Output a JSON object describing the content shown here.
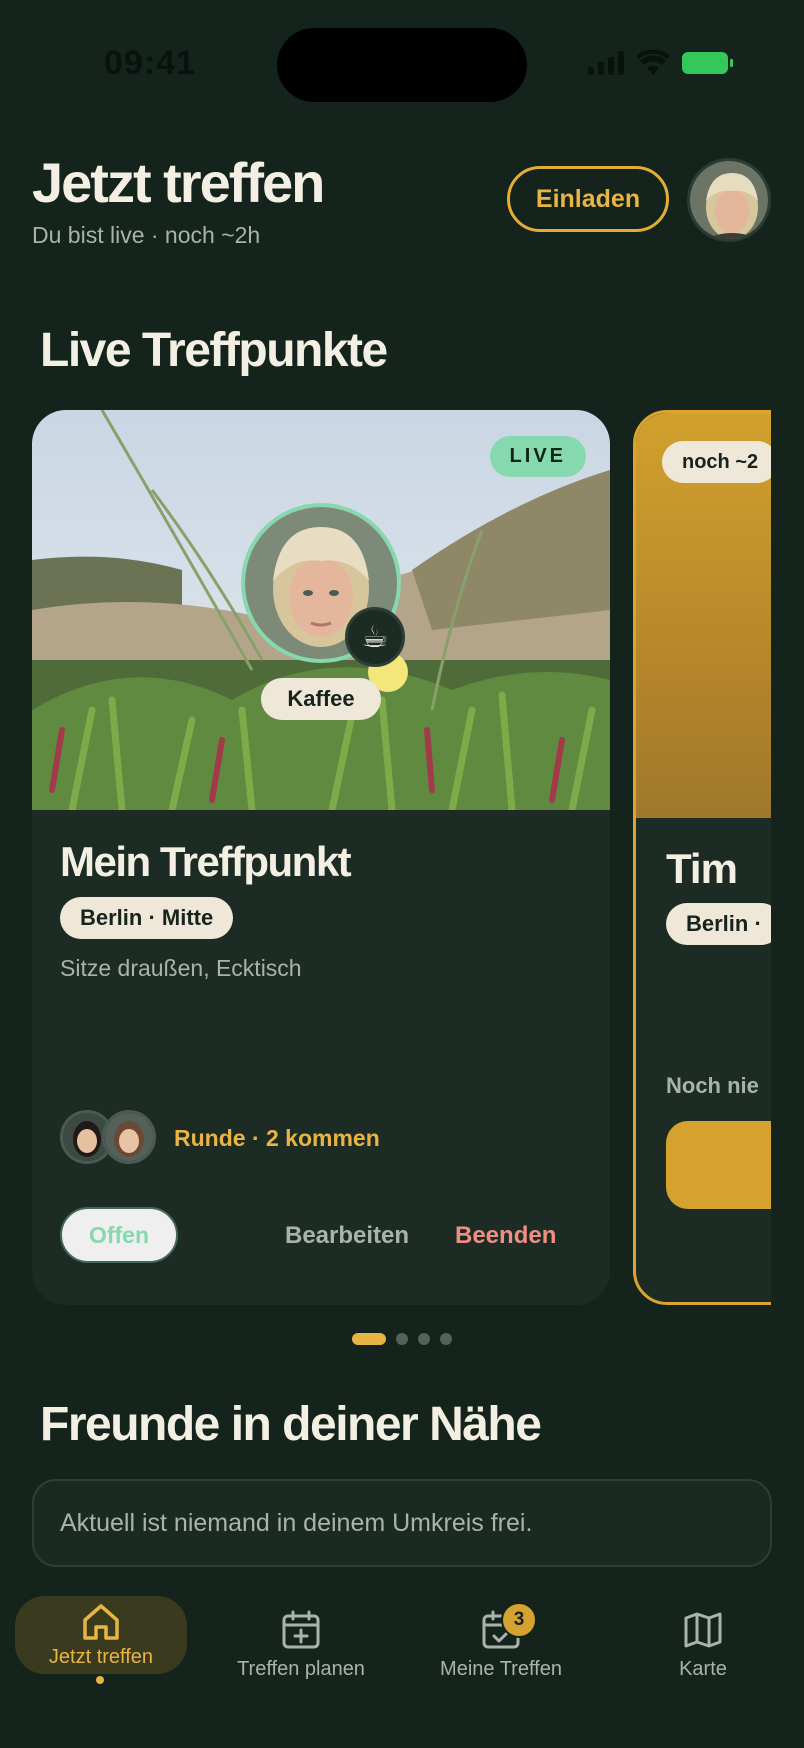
{
  "status_bar": {
    "time": "09:41"
  },
  "header": {
    "title": "Jetzt treffen",
    "subtitle": "Du bist live · noch ~2h",
    "invite_label": "Einladen"
  },
  "live_section": {
    "title": "Live Treffpunkte",
    "cards": [
      {
        "badge": "LIVE",
        "activity": "Kaffee",
        "activity_icon": "coffee-icon",
        "name": "Mein Treffpunkt",
        "location": "Berlin · Mitte",
        "note": "Sitze draußen, Ecktisch",
        "round_text": "Runde · 2 kommen",
        "status_label": "Offen",
        "edit_label": "Bearbeiten",
        "end_label": "Beenden"
      },
      {
        "time_badge": "noch ~2",
        "name": "Tim",
        "location": "Berlin ·",
        "status_text": "Noch nie"
      }
    ],
    "pager": {
      "count": 4,
      "active": 0
    }
  },
  "friends_section": {
    "title": "Freunde in deiner Nähe",
    "empty_text": "Aktuell ist niemand in deinem Umkreis frei."
  },
  "tabbar": {
    "items": [
      {
        "label": "Jetzt treffen",
        "icon": "home-icon",
        "active": true
      },
      {
        "label": "Treffen planen",
        "icon": "calendar-plus-icon",
        "active": false
      },
      {
        "label": "Meine Treffen",
        "icon": "calendar-check-icon",
        "active": false,
        "badge": "3"
      },
      {
        "label": "Karte",
        "icon": "map-icon",
        "active": false
      }
    ]
  },
  "colors": {
    "background": "#14241d",
    "card": "#1c2c25",
    "accent": "#e8b544",
    "live_green": "#86d9ae",
    "danger": "#ef8f82"
  }
}
